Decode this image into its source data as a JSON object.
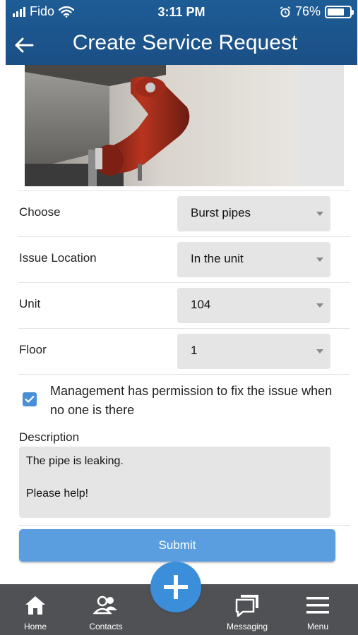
{
  "status_bar": {
    "carrier": "Fido",
    "time": "3:11 PM",
    "battery": "76%",
    "battery_level": 0.76
  },
  "header": {
    "title": "Create Service Request",
    "back_icon": "arrow-left-icon"
  },
  "form": {
    "rows": [
      {
        "label": "Choose",
        "value": "Burst pipes"
      },
      {
        "label": "Issue Location",
        "value": "In the unit"
      },
      {
        "label": "Unit",
        "value": "104"
      },
      {
        "label": "Floor",
        "value": "1"
      }
    ],
    "permission": {
      "checked": true,
      "text": "Management has permission to fix the issue when no one is there"
    },
    "description": {
      "label": "Description",
      "value": "The pipe is leaking.\n\nPlease help!"
    },
    "submit_label": "Submit"
  },
  "tab_bar": {
    "items": [
      {
        "label": "Home",
        "icon": "home-icon"
      },
      {
        "label": "Contacts",
        "icon": "contacts-icon"
      },
      {
        "label": "Messaging",
        "icon": "messaging-icon"
      },
      {
        "label": "Menu",
        "icon": "menu-icon"
      }
    ],
    "fab_icon": "plus-icon"
  },
  "colors": {
    "header": "#1e5c96",
    "accent": "#3b8fda",
    "submit": "#5b9ee0",
    "tab_bar": "#505154"
  }
}
